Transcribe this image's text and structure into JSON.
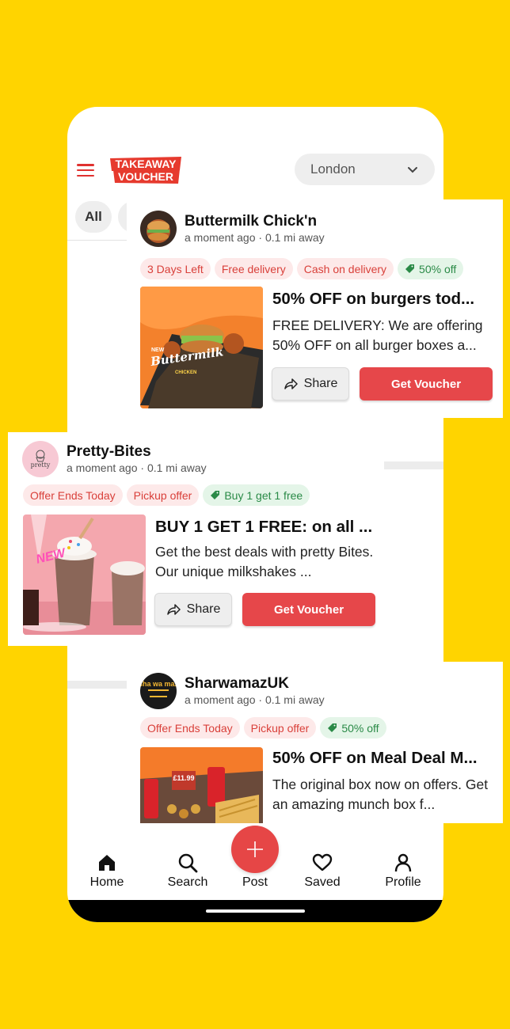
{
  "header": {
    "logo_line1": "TAKEAWAY",
    "logo_line2": "VOUCHER",
    "location": "London"
  },
  "filters": {
    "all_label": "All"
  },
  "deals": [
    {
      "shop": "Buttermilk Chick'n",
      "meta": "a moment ago · 0.1 mi away",
      "tags": [
        "3 Days Left",
        "Free delivery",
        "Cash on delivery"
      ],
      "discount_tag": "50% off",
      "title": "50% OFF on burgers tod...",
      "description": "FREE DELIVERY: We are offering 50% OFF on all burger boxes a...",
      "image_text_new": "NEW",
      "image_text_brand": "Buttermilk",
      "image_text_sub": "CHICKEN",
      "share_label": "Share",
      "voucher_label": "Get Voucher"
    },
    {
      "shop": "Pretty-Bites",
      "avatar_text": "pretty",
      "meta": "a moment ago · 0.1 mi away",
      "tags": [
        "Offer Ends Today",
        "Pickup offer"
      ],
      "discount_tag": "Buy 1 get 1 free",
      "title": "BUY 1 GET 1 FREE: on all ...",
      "description": "Get the best deals with pretty Bites. Our unique  milkshakes ...",
      "image_text_new": "NEW",
      "share_label": "Share",
      "voucher_label": "Get Voucher"
    },
    {
      "shop": "SharwamazUK",
      "avatar_text": "sha wa maz",
      "meta": "a moment ago · 0.1 mi away",
      "tags": [
        "Offer Ends Today",
        "Pickup offer"
      ],
      "discount_tag": "50% off",
      "title": "50% OFF on Meal Deal M...",
      "description": "The original box now on offers. Get an amazing munch box f...",
      "image_price": "£11.99"
    }
  ],
  "nav": {
    "home": "Home",
    "search": "Search",
    "post": "Post",
    "saved": "Saved",
    "profile": "Profile"
  },
  "colors": {
    "background": "#FFD400",
    "accent_red": "#e6474a",
    "tag_red_text": "#d9403a",
    "tag_green_text": "#2a8a47"
  }
}
